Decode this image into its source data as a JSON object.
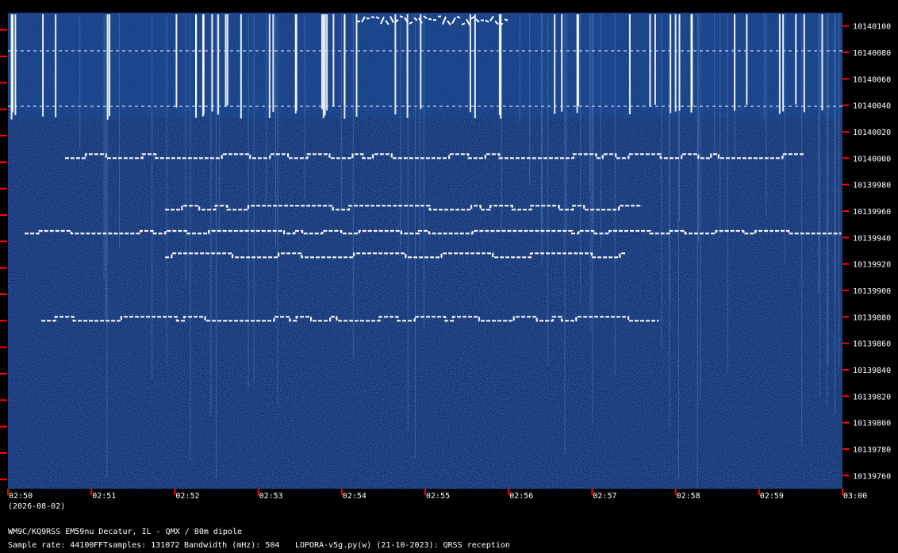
{
  "chart_data": {
    "type": "heatmap",
    "subtype": "spectrogram (QRSS waterfall)",
    "x_time_labels": [
      "02:50",
      "02:51",
      "02:52",
      "02:53",
      "02:54",
      "02:55",
      "02:56",
      "02:57",
      "02:58",
      "02:59",
      "03:00"
    ],
    "date_label": "(2026-08-02)",
    "y_freq_labels": [
      10140100,
      10140080,
      10140060,
      10140040,
      10140020,
      10140000,
      10139980,
      10139960,
      10139940,
      10139920,
      10139900,
      10139880,
      10139860,
      10139840,
      10139820,
      10139800,
      10139780,
      10139760
    ],
    "x_range": [
      "02:50",
      "03:00"
    ],
    "y_range": [
      10139750,
      10140110
    ],
    "colors": {
      "background": "#0d2c6e",
      "noise_light": "#2f63b6",
      "signal": "#ffffff",
      "tick": "#ff0000",
      "label": "#ffffff",
      "frame": "#000000"
    },
    "signals": [
      {
        "center_freq": 10140000,
        "shift": 3,
        "start": "02:50:41",
        "end": "02:59:33"
      },
      {
        "center_freq": 10139961,
        "shift": 3,
        "start": "02:51:53",
        "end": "02:57:36"
      },
      {
        "center_freq": 10139925,
        "shift": 3,
        "start": "02:51:53",
        "end": "02:57:24"
      },
      {
        "center_freq": 10139943,
        "shift": 2,
        "start": "02:50:12",
        "end": "02:59:59"
      },
      {
        "center_freq": 10139877,
        "shift": 3,
        "start": "02:50:24",
        "end": "02:57:48"
      }
    ]
  },
  "footer": {
    "station": "WM9C/KQ9RSS EM59nu Decatur, IL - QMX / 80m dipole",
    "sample_rate": "Sample rate: 44100",
    "fft_samples": "FFTsamples: 131072",
    "bandwidth": "Bandwidth (mHz): 504",
    "software": "LOPORA-v5g.py(w) (21-10-2023): QRSS reception"
  }
}
